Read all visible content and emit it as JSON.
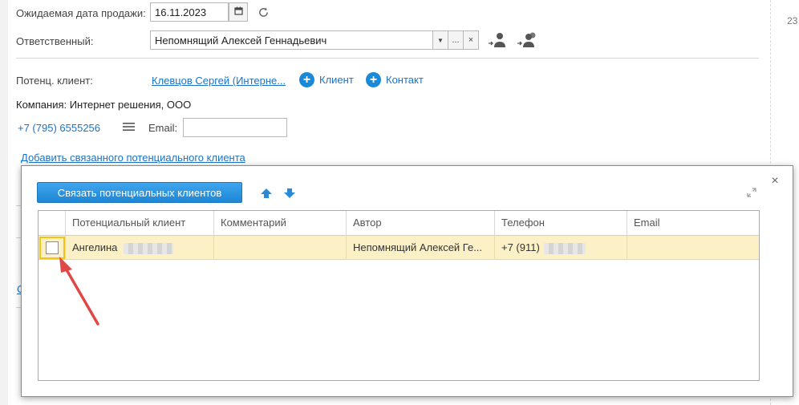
{
  "form": {
    "sale_date": {
      "label": "Ожидаемая дата продажи:",
      "value": "16.11.2023"
    },
    "responsible": {
      "label": "Ответственный:",
      "value": "Непомнящий Алексей Геннадьевич",
      "more_label": "..."
    },
    "potential_client": {
      "label": "Потенц. клиент:",
      "value": "Клевцов Сергей (Интерне...",
      "add_client_label": "Клиент",
      "add_contact_label": "Контакт"
    },
    "company": "Компания: Интернет решения, ООО",
    "phone": "+7 (795) 6555256",
    "email": {
      "label": "Email:",
      "value": ""
    },
    "add_related_link": "Добавить связанного потенциального клиента",
    "left_link_fragment": "С"
  },
  "gutter": {
    "number": "23"
  },
  "dialog": {
    "link_button": "Связать потенциальных клиентов",
    "close": "×",
    "columns": [
      "Потенциальный клиент",
      "Комментарий",
      "Автор",
      "Телефон",
      "Email"
    ],
    "rows": [
      {
        "client": "Ангелина",
        "comment": "",
        "author": "Непомнящий Алексей Ге...",
        "phone": "+7 (911)",
        "email": "",
        "checked": false
      }
    ]
  },
  "colors": {
    "accent": "#1a8ad8",
    "selected_row": "#fbf0c6",
    "arrow": "#e04848"
  },
  "icons": [
    "calendar-icon",
    "refresh-icon",
    "assign-user-icon",
    "assign-group-icon",
    "plus-icon",
    "menu-icon",
    "arrow-up-icon",
    "arrow-down-icon",
    "expand-icon"
  ]
}
